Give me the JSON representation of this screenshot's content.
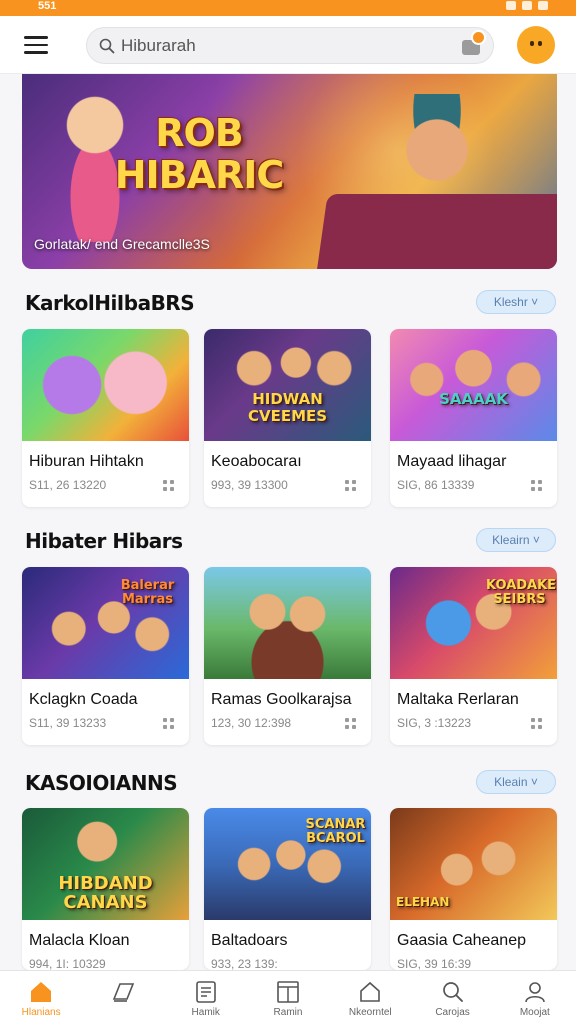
{
  "status_bar": {
    "time": "551"
  },
  "header": {
    "search_placeholder": "Hiburarah",
    "search_value": ""
  },
  "hero": {
    "title": "ROB HIBARIC",
    "subtitle": "Gorlatak/ end Grecamclle3S"
  },
  "sections": [
    {
      "title": "KarkolHiIbaBRS",
      "see_all": "Kleshr",
      "cards": [
        {
          "title": "Hiburan Hihtakn",
          "meta": "S11, 26 13220",
          "thumb_label": ""
        },
        {
          "title": "Keoabocaraı",
          "meta": "993, 39 13300",
          "thumb_label": "HIDWAN CVEEMES"
        },
        {
          "title": "Mayaad lihagar",
          "meta": "SIG, 86 13339",
          "thumb_label": "SAAAAK"
        }
      ]
    },
    {
      "title": "Hibater Hibars",
      "see_all": "Kleairn",
      "cards": [
        {
          "title": "Kclagkn Coada",
          "meta": "S11, 39 13233",
          "thumb_label": "Balerar Marras"
        },
        {
          "title": "Ramas Goolkarajsa",
          "meta": "123, 30 12:398",
          "thumb_label": ""
        },
        {
          "title": "Maltaka Rerlaran",
          "meta": "SIG, 3 :13223",
          "thumb_label": "KOADAKE SEIBRS"
        }
      ]
    },
    {
      "title": "KASOIOIANNS",
      "see_all": "Kleain",
      "cards": [
        {
          "title": "Malacla Kloan",
          "meta": "994, 1I: 10329",
          "thumb_label": "HIBDAND CANANS"
        },
        {
          "title": "Baltadoars",
          "meta": "933, 23 139:",
          "thumb_label": "SCANAR BCAROL"
        },
        {
          "title": "Gaasia Caheanep",
          "meta": "SIG, 39 16:39",
          "thumb_label": "ELEHAN"
        }
      ]
    }
  ],
  "bottom_nav": [
    {
      "label": "Hlanians",
      "icon": "home-icon",
      "active": true
    },
    {
      "label": "",
      "icon": "tag-icon",
      "active": false
    },
    {
      "label": "Hamik",
      "icon": "list-icon",
      "active": false
    },
    {
      "label": "Ramin",
      "icon": "board-icon",
      "active": false
    },
    {
      "label": "Nkeorntel",
      "icon": "house-outline-icon",
      "active": false
    },
    {
      "label": "Carojas",
      "icon": "search-icon",
      "active": false
    },
    {
      "label": "Moojat",
      "icon": "profile-icon",
      "active": false
    }
  ],
  "colors": {
    "accent": "#f7931e",
    "see_all_bg": "#dcecfb",
    "see_all_text": "#5a7fb0"
  }
}
